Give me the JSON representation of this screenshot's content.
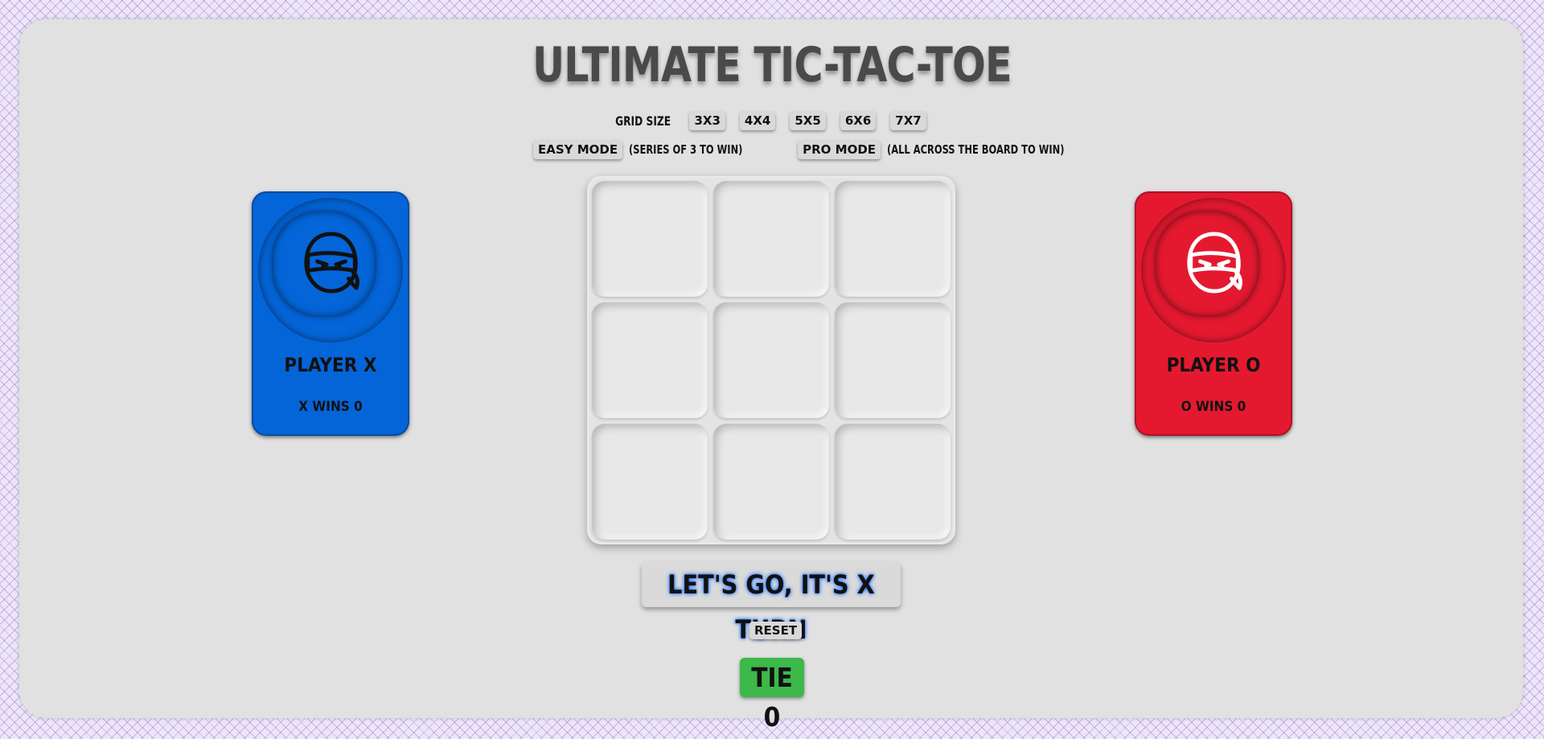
{
  "title": "ULTIMATE TIC-TAC-TOE",
  "grid_size": {
    "label": "GRID SIZE",
    "options": [
      "3X3",
      "4X4",
      "5X5",
      "6X6",
      "7X7"
    ]
  },
  "modes": {
    "easy_label": "EASY MODE",
    "easy_note": "(SERIES OF 3 TO WIN)",
    "pro_label": "PRO MODE",
    "pro_note": "(ALL ACROSS THE BOARD TO WIN)"
  },
  "player_x": {
    "name": "PLAYER X",
    "wins": "X WINS 0",
    "color": "#0465d8",
    "icon": "ninja-icon"
  },
  "player_o": {
    "name": "PLAYER O",
    "wins": "O WINS 0",
    "color": "#e41930",
    "icon": "ninja-icon"
  },
  "board": {
    "size": 3,
    "cells": [
      "",
      "",
      "",
      "",
      "",
      "",
      "",
      "",
      ""
    ]
  },
  "status": "LET'S GO, IT'S X TURN",
  "reset_label": "RESET",
  "tie": "TIE 0"
}
